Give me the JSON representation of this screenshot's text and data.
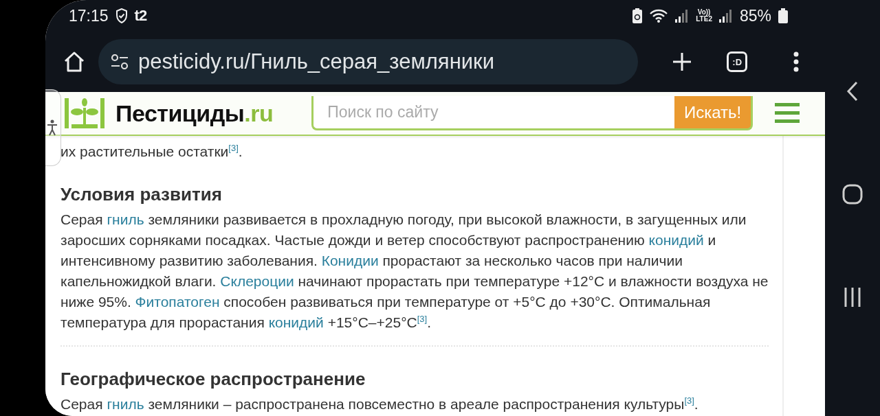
{
  "status_bar": {
    "time": "17:15",
    "carrier": "t2",
    "battery": "85%",
    "network": "Vo))\nLTE2"
  },
  "browser": {
    "url": "pesticidy.ru/Гниль_серая_земляники",
    "tab_switcher": ":D"
  },
  "site_header": {
    "logo_text": "Пестициды",
    "logo_suffix": ".ru",
    "search": {
      "placeholder": "Поиск по сайту"
    },
    "search_button": "Искать!"
  },
  "article": {
    "blocks": [
      {
        "kind": "paragraph",
        "segments": [
          {
            "kind": "text",
            "text": "их растительные остатки"
          },
          {
            "kind": "ref",
            "text": "[3]"
          },
          {
            "kind": "text",
            "text": "."
          }
        ]
      },
      {
        "kind": "heading",
        "text": "Условия развития"
      },
      {
        "kind": "paragraph",
        "segments": [
          {
            "kind": "text",
            "text": "Серая "
          },
          {
            "kind": "link",
            "text": "гниль"
          },
          {
            "kind": "text",
            "text": " земляники развивается в прохладную погоду, при высокой влажности, в загущенных или заросших сорняками посадках. Частые дожди и ветер способствуют распространению "
          },
          {
            "kind": "link",
            "text": "конидий"
          },
          {
            "kind": "text",
            "text": " и интенсивному развитию заболевания. "
          },
          {
            "kind": "link",
            "text": "Конидии"
          },
          {
            "kind": "text",
            "text": " прорастают за несколько часов при наличии капельножидкой влаги. "
          },
          {
            "kind": "link",
            "text": "Склероции"
          },
          {
            "kind": "text",
            "text": " начинают прорастать при температуре +12°C и влажности воздуха не ниже 95%. "
          },
          {
            "kind": "link",
            "text": "Фитопатоген"
          },
          {
            "kind": "text",
            "text": " способен развиваться при температуре от +5°C до +30°C. Оптимальная температура для прорастания "
          },
          {
            "kind": "link",
            "text": "конидий"
          },
          {
            "kind": "text",
            "text": " +15°C–+25°C"
          },
          {
            "kind": "ref",
            "text": "[3]"
          },
          {
            "kind": "text",
            "text": "."
          }
        ]
      },
      {
        "kind": "divider"
      },
      {
        "kind": "heading",
        "text": "Географическое распространение"
      },
      {
        "kind": "paragraph",
        "segments": [
          {
            "kind": "text",
            "text": "Серая "
          },
          {
            "kind": "link",
            "text": "гниль"
          },
          {
            "kind": "text",
            "text": " земляники – распространена повсеместно в ареале распространения культуры"
          },
          {
            "kind": "ref",
            "text": "[3]"
          },
          {
            "kind": "text",
            "text": "."
          }
        ]
      }
    ]
  }
}
